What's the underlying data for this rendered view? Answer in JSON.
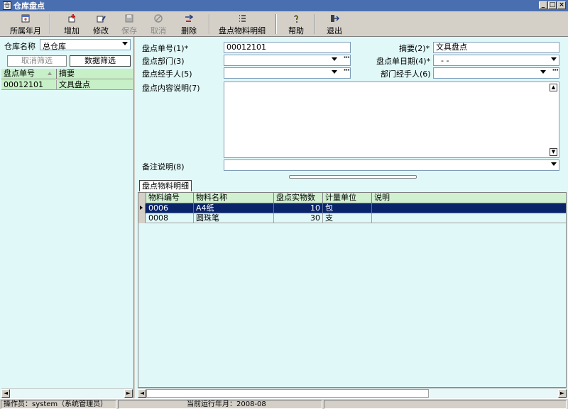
{
  "window": {
    "title": "仓库盘点",
    "app_icon": "仓",
    "min": "_",
    "max": "□",
    "close": "×"
  },
  "toolbar": {
    "period": "所属年月",
    "add": "增加",
    "edit": "修改",
    "save": "保存",
    "cancel": "取消",
    "delete": "删除",
    "detail": "盘点物料明细",
    "help": "帮助",
    "exit": "退出"
  },
  "left": {
    "warehouse_label": "仓库名称",
    "warehouse_value": "总仓库",
    "clear_filter": "取消筛选",
    "filter": "数据筛选",
    "columns": [
      "盘点单号",
      "摘要"
    ],
    "rows": [
      {
        "no": "00012101",
        "summary": "文具盘点"
      }
    ]
  },
  "form": {
    "no_label": "盘点单号(1)*",
    "no_value": "00012101",
    "summary_label": "摘要(2)*",
    "summary_value": "文具盘点",
    "dept_label": "盘点部门(3)",
    "dept_value": "",
    "date_label": "盘点单日期(4)*",
    "date_value": "-   -",
    "handler_label": "盘点经手人(5)",
    "handler_value": "",
    "dept_handler_label": "部门经手人(6)",
    "dept_handler_value": "",
    "desc_label": "盘点内容说明(7)",
    "desc_value": "",
    "remark_label": "备注说明(8)",
    "remark_value": ""
  },
  "detail": {
    "tab_label": "盘点物料明细",
    "columns": [
      "物料编号",
      "物料名称",
      "盘点实物数",
      "计量单位",
      "说明"
    ],
    "rows": [
      {
        "code": "0006",
        "name": "A4纸",
        "qty": "10",
        "unit": "包",
        "note": ""
      },
      {
        "code": "0008",
        "name": "圆珠笔",
        "qty": "30",
        "unit": "支",
        "note": ""
      }
    ]
  },
  "status": {
    "operator": "操作员：system（系统管理员）",
    "period": "当前运行年月：2008-08"
  }
}
